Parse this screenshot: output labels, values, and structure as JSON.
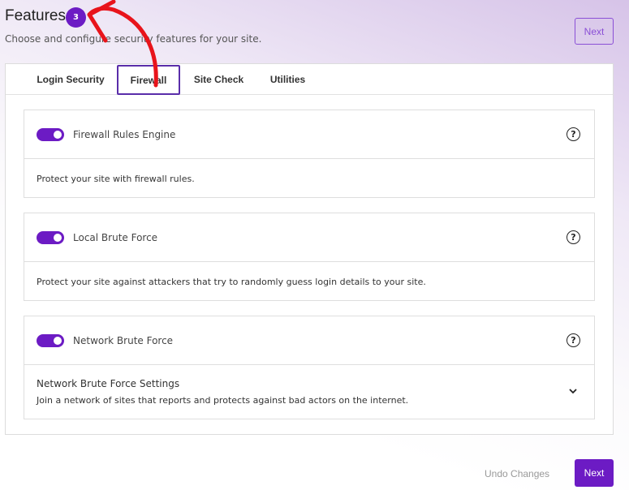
{
  "header": {
    "title": "Features",
    "badge": "3",
    "subtitle": "Choose and configure security features for your site.",
    "next_label": "Next"
  },
  "tabs": [
    {
      "label": "Login Security"
    },
    {
      "label": "Firewall",
      "active": true
    },
    {
      "label": "Site Check"
    },
    {
      "label": "Utilities"
    }
  ],
  "panels": [
    {
      "title": "Firewall Rules Engine",
      "enabled": true,
      "description": "Protect your site with firewall rules."
    },
    {
      "title": "Local Brute Force",
      "enabled": true,
      "description": "Protect your site against attackers that try to randomly guess login details to your site."
    },
    {
      "title": "Network Brute Force",
      "enabled": true,
      "settings_title": "Network Brute Force Settings",
      "description": "Join a network of sites that reports and protects against bad actors on the internet."
    }
  ],
  "footer": {
    "undo_label": "Undo Changes",
    "next_label": "Next"
  },
  "help_glyph": "?",
  "colors": {
    "accent": "#6c1bc4",
    "annotation": "#e8141b"
  }
}
